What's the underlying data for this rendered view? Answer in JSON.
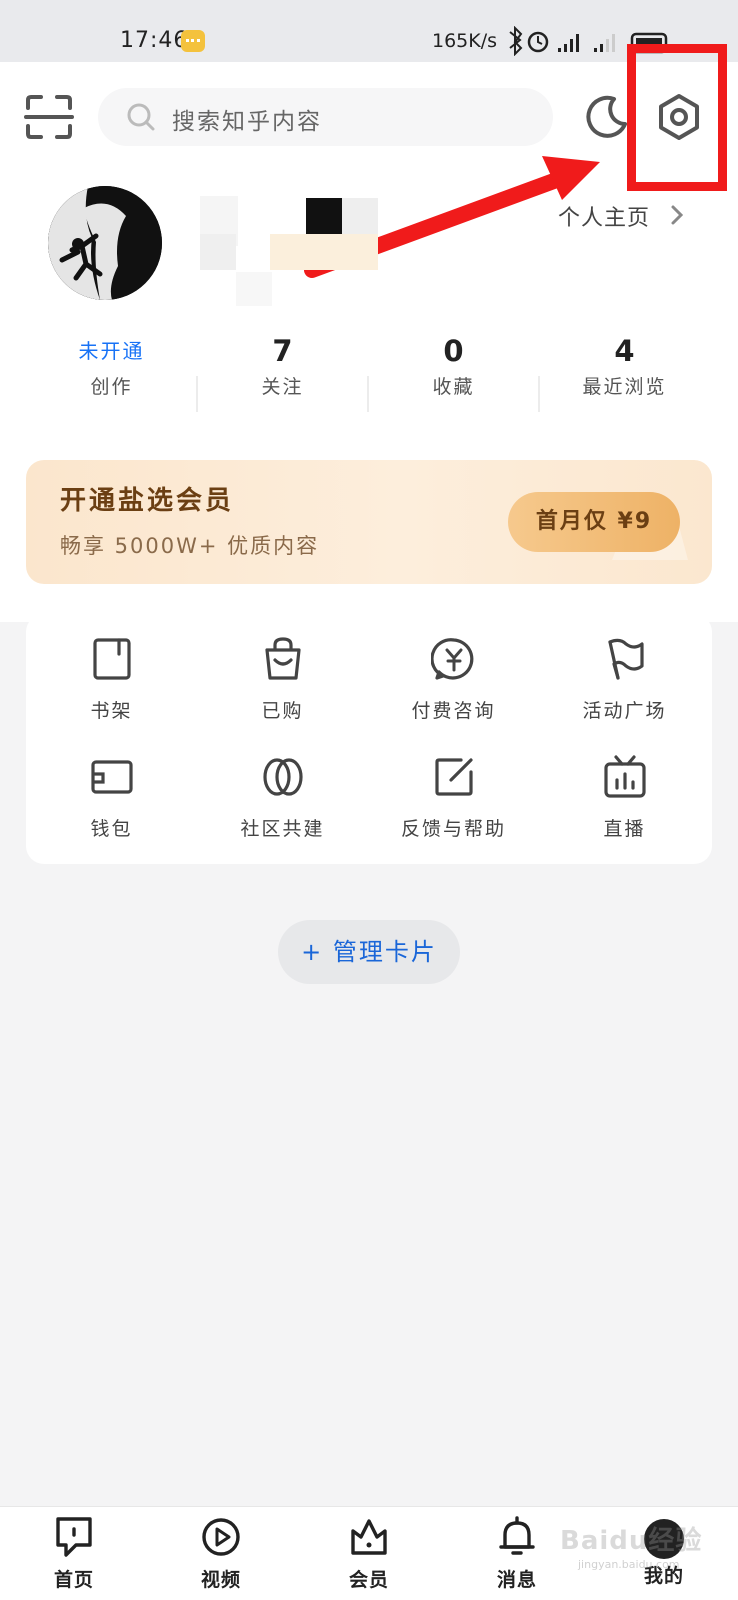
{
  "status_bar": {
    "time": "17:46",
    "speed": "165K/s"
  },
  "header": {
    "search_placeholder": "搜索知乎内容"
  },
  "profile": {
    "home_link": "个人主页"
  },
  "stats": [
    {
      "value": "未开通",
      "label": "创作"
    },
    {
      "value": "7",
      "label": "关注"
    },
    {
      "value": "0",
      "label": "收藏"
    },
    {
      "value": "4",
      "label": "最近浏览"
    }
  ],
  "vip": {
    "title": "开通盐选会员",
    "subtitle": "畅享 5000W+ 优质内容",
    "button": "首月仅 ¥9"
  },
  "tools": [
    {
      "label": "书架",
      "icon": "bookshelf-icon"
    },
    {
      "label": "已购",
      "icon": "shopping-bag-icon"
    },
    {
      "label": "付费咨询",
      "icon": "paid-consult-icon"
    },
    {
      "label": "活动广场",
      "icon": "flag-icon"
    },
    {
      "label": "钱包",
      "icon": "wallet-icon"
    },
    {
      "label": "社区共建",
      "icon": "community-icon"
    },
    {
      "label": "反馈与帮助",
      "icon": "feedback-icon"
    },
    {
      "label": "直播",
      "icon": "live-tv-icon"
    }
  ],
  "manage_cards": "+ 管理卡片",
  "tabs": [
    {
      "label": "首页",
      "icon": "home-icon"
    },
    {
      "label": "视频",
      "icon": "video-icon"
    },
    {
      "label": "会员",
      "icon": "crown-icon"
    },
    {
      "label": "消息",
      "icon": "bell-icon"
    },
    {
      "label": "我的",
      "icon": "profile-avatar-icon"
    }
  ],
  "watermark": {
    "text": "Baidu经验",
    "url": "jingyan.baidu.com"
  },
  "colors": {
    "accent_blue": "#1772f6",
    "annotation_red": "#f01b1b",
    "vip_gold": "#eeb266"
  }
}
